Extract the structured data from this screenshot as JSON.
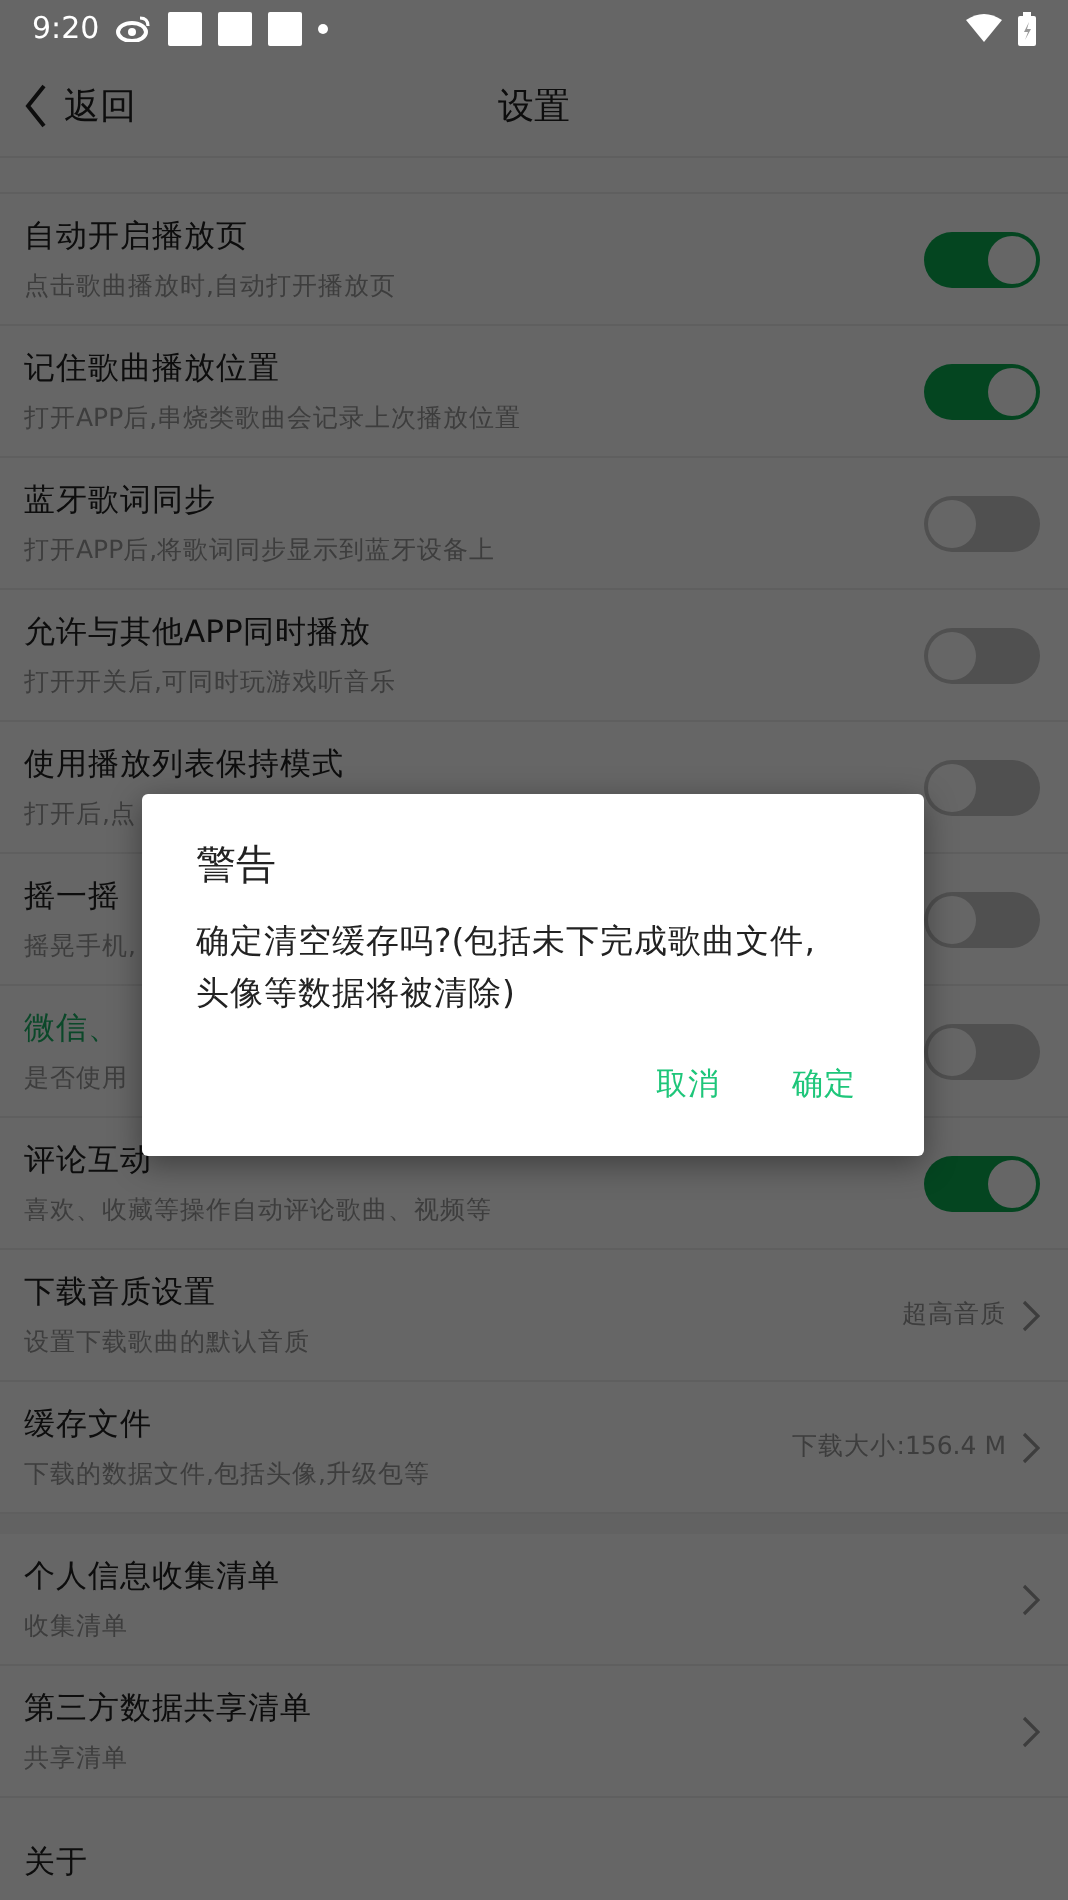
{
  "status_bar": {
    "time": "9:20"
  },
  "header": {
    "back": "返回",
    "title": "设置"
  },
  "settings": [
    {
      "kind": "toggle",
      "title": "自动开启播放页",
      "subtitle": "点击歌曲播放时,自动打开播放页",
      "on": true,
      "highlighted": false
    },
    {
      "kind": "toggle",
      "title": "记住歌曲播放位置",
      "subtitle": "打开APP后,串烧类歌曲会记录上次播放位置",
      "on": true,
      "highlighted": false
    },
    {
      "kind": "toggle",
      "title": "蓝牙歌词同步",
      "subtitle": "打开APP后,将歌词同步显示到蓝牙设备上",
      "on": false,
      "highlighted": false
    },
    {
      "kind": "toggle",
      "title": "允许与其他APP同时播放",
      "subtitle": "打开开关后,可同时玩游戏听音乐",
      "on": false,
      "highlighted": false
    },
    {
      "kind": "toggle",
      "title": "使用播放列表保持模式",
      "subtitle": "打开后,点",
      "on": false,
      "highlighted": false
    },
    {
      "kind": "toggle",
      "title": "摇一摇",
      "subtitle": "摇晃手机,",
      "on": false,
      "highlighted": false
    },
    {
      "kind": "toggle",
      "title": "微信、",
      "subtitle": "是否使用",
      "on": false,
      "highlighted": true
    },
    {
      "kind": "toggle",
      "title": "评论互动",
      "subtitle": "喜欢、收藏等操作自动评论歌曲、视频等",
      "on": true,
      "highlighted": false
    },
    {
      "kind": "link",
      "title": "下载音质设置",
      "subtitle": "设置下载歌曲的默认音质",
      "value": "超高音质",
      "highlighted": false
    },
    {
      "kind": "link",
      "title": "缓存文件",
      "subtitle": "下载的数据文件,包括头像,升级包等",
      "value": "下载大小:156.4 M",
      "highlighted": false
    },
    {
      "kind": "gap"
    },
    {
      "kind": "link",
      "title": "个人信息收集清单",
      "subtitle": "收集清单",
      "highlighted": false
    },
    {
      "kind": "link",
      "title": "第三方数据共享清单",
      "subtitle": "共享清单",
      "highlighted": false
    },
    {
      "kind": "plain",
      "title": "关于",
      "highlighted": false
    }
  ],
  "dialog": {
    "title": "警告",
    "message": "确定清空缓存吗?(包括未下完成歌曲文件,头像等数据将被清除)",
    "buttons": [
      "取消",
      "确定"
    ]
  }
}
